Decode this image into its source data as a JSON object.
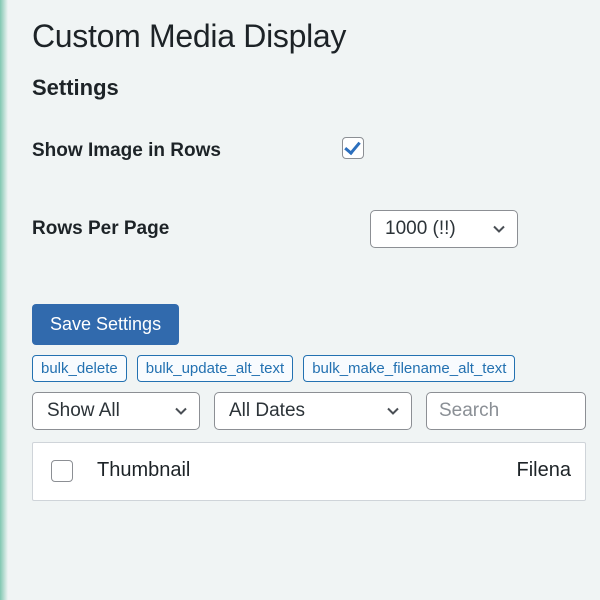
{
  "page": {
    "title": "Custom Media Display",
    "section_title": "Settings"
  },
  "settings": {
    "show_image_label": "Show Image in Rows",
    "show_image_checked": true,
    "rows_per_page_label": "Rows Per Page",
    "rows_per_page_value": "1000 (!!)"
  },
  "actions": {
    "save_label": "Save Settings",
    "bulk_buttons": [
      "bulk_delete",
      "bulk_update_alt_text",
      "bulk_make_filename_alt_text"
    ]
  },
  "filters": {
    "show_all_label": "Show All",
    "all_dates_label": "All Dates",
    "search_placeholder": "Search"
  },
  "table": {
    "columns": {
      "thumbnail": "Thumbnail",
      "filename": "Filena"
    }
  }
}
